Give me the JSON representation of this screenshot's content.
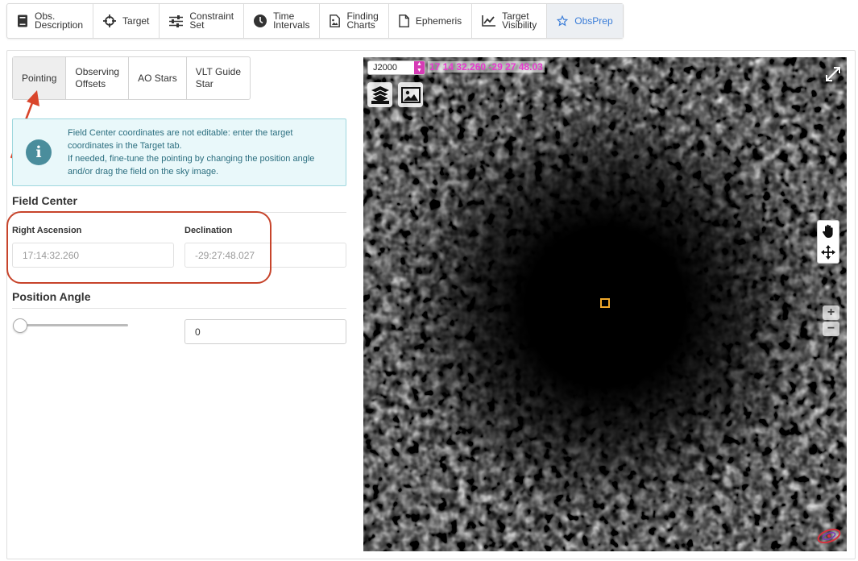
{
  "tabs": [
    {
      "label": "Obs.\nDescription",
      "icon": "book-icon"
    },
    {
      "label": "Target",
      "icon": "crosshair-icon"
    },
    {
      "label": "Constraint\nSet",
      "icon": "sliders-icon"
    },
    {
      "label": "Time\nIntervals",
      "icon": "clock-icon"
    },
    {
      "label": "Finding\nCharts",
      "icon": "image-file-icon"
    },
    {
      "label": "Ephemeris",
      "icon": "file-icon"
    },
    {
      "label": "Target\nVisibility",
      "icon": "line-chart-icon"
    },
    {
      "label": "ObsPrep",
      "icon": "star-icon",
      "active": true
    }
  ],
  "subtabs": [
    {
      "label": "Pointing",
      "active": true
    },
    {
      "label": "Observing\nOffsets"
    },
    {
      "label": "AO Stars"
    },
    {
      "label": "VLT Guide\nStar"
    }
  ],
  "info": {
    "line1": "Field Center coordinates are not editable: enter the target coordinates in the Target tab.",
    "line2": "If needed, fine-tune the pointing by changing the position angle and/or drag the field on the sky image."
  },
  "field_center": {
    "title": "Field Center",
    "ra_label": "Right Ascension",
    "ra_value": "17:14:32.260",
    "dec_label": "Declination",
    "dec_value": "-29:27:48.027"
  },
  "position_angle": {
    "title": "Position Angle",
    "value": "0",
    "slider_fraction": 0
  },
  "sky_view": {
    "frame": "J2000",
    "coords": "17 14 32.260 -29 27 48.03"
  },
  "colors": {
    "accent": "#3b7dd8",
    "highlight": "#c7442b",
    "info_bg": "#e9f8fa",
    "coords": "#e63ccf",
    "target_box": "#f0a82b"
  }
}
